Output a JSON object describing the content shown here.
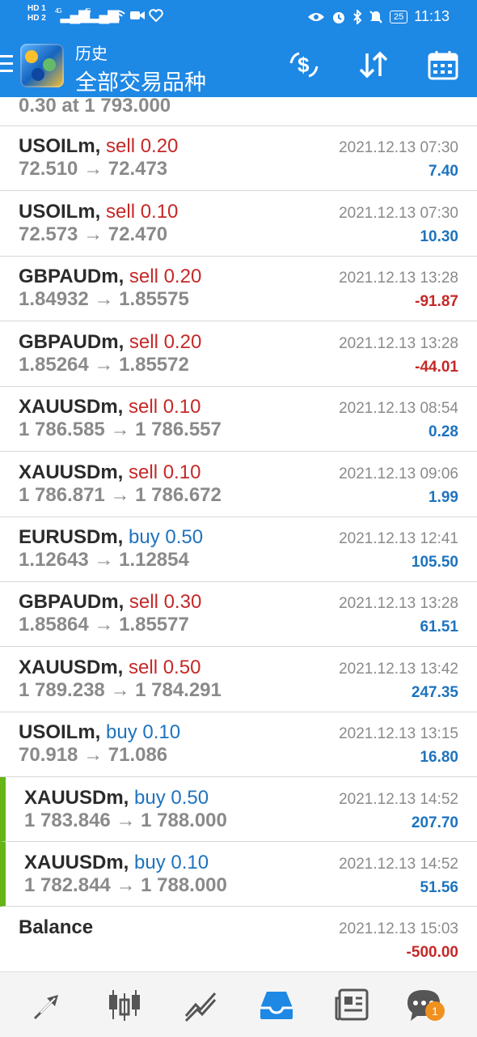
{
  "status_bar": {
    "left_labels": [
      "HD 1",
      "HD 2"
    ],
    "net_labels": [
      "4G",
      "4G"
    ],
    "battery": "25",
    "time": "11:13"
  },
  "app_bar": {
    "title": "历史",
    "subtitle": "全部交易品种"
  },
  "partial_row": {
    "line": "0.30 at 1 793.000"
  },
  "rows": [
    {
      "symbol": "USOILm,",
      "side": "sell 0.20",
      "prices": "72.510 → 72.473",
      "time": "2021.12.13 07:30",
      "profit": "7.40"
    },
    {
      "symbol": "USOILm,",
      "side": "sell 0.10",
      "prices": "72.573 → 72.470",
      "time": "2021.12.13 07:30",
      "profit": "10.30"
    },
    {
      "symbol": "GBPAUDm,",
      "side": "sell 0.20",
      "prices": "1.84932 → 1.85575",
      "time": "2021.12.13 13:28",
      "profit": "-91.87"
    },
    {
      "symbol": "GBPAUDm,",
      "side": "sell 0.20",
      "prices": "1.85264 → 1.85572",
      "time": "2021.12.13 13:28",
      "profit": "-44.01"
    },
    {
      "symbol": "XAUUSDm,",
      "side": "sell 0.10",
      "prices": "1 786.585 → 1 786.557",
      "time": "2021.12.13 08:54",
      "profit": "0.28"
    },
    {
      "symbol": "XAUUSDm,",
      "side": "sell 0.10",
      "prices": "1 786.871 → 1 786.672",
      "time": "2021.12.13 09:06",
      "profit": "1.99"
    },
    {
      "symbol": "EURUSDm,",
      "side": "buy 0.50",
      "prices": "1.12643 → 1.12854",
      "time": "2021.12.13 12:41",
      "profit": "105.50"
    },
    {
      "symbol": "GBPAUDm,",
      "side": "sell 0.30",
      "prices": "1.85864 → 1.85577",
      "time": "2021.12.13 13:28",
      "profit": "61.51"
    },
    {
      "symbol": "XAUUSDm,",
      "side": "sell 0.50",
      "prices": "1 789.238 → 1 784.291",
      "time": "2021.12.13 13:42",
      "profit": "247.35"
    },
    {
      "symbol": "USOILm,",
      "side": "buy 0.10",
      "prices": "70.918 → 71.086",
      "time": "2021.12.13 13:15",
      "profit": "16.80"
    },
    {
      "symbol": "XAUUSDm,",
      "side": "buy 0.50",
      "prices": "1 783.846 → 1 788.000",
      "time": "2021.12.13 14:52",
      "profit": "207.70"
    },
    {
      "symbol": "XAUUSDm,",
      "side": "buy 0.10",
      "prices": "1 782.844 → 1 788.000",
      "time": "2021.12.13 14:52",
      "profit": "51.56"
    },
    {
      "symbol": "Balance",
      "side": "",
      "prices": "",
      "time": "2021.12.13 15:03",
      "profit": "-500.00"
    }
  ],
  "bottom_nav": {
    "items": [
      "trade-icon",
      "candles-icon",
      "chart-icon",
      "history-icon",
      "news-icon",
      "chat-icon"
    ],
    "chat_badge": "1"
  },
  "colors": {
    "primary": "#1e88e5",
    "sell": "#c62828",
    "buy": "#1e73be",
    "open_marker": "#64b515",
    "muted": "#8a8a8a"
  }
}
